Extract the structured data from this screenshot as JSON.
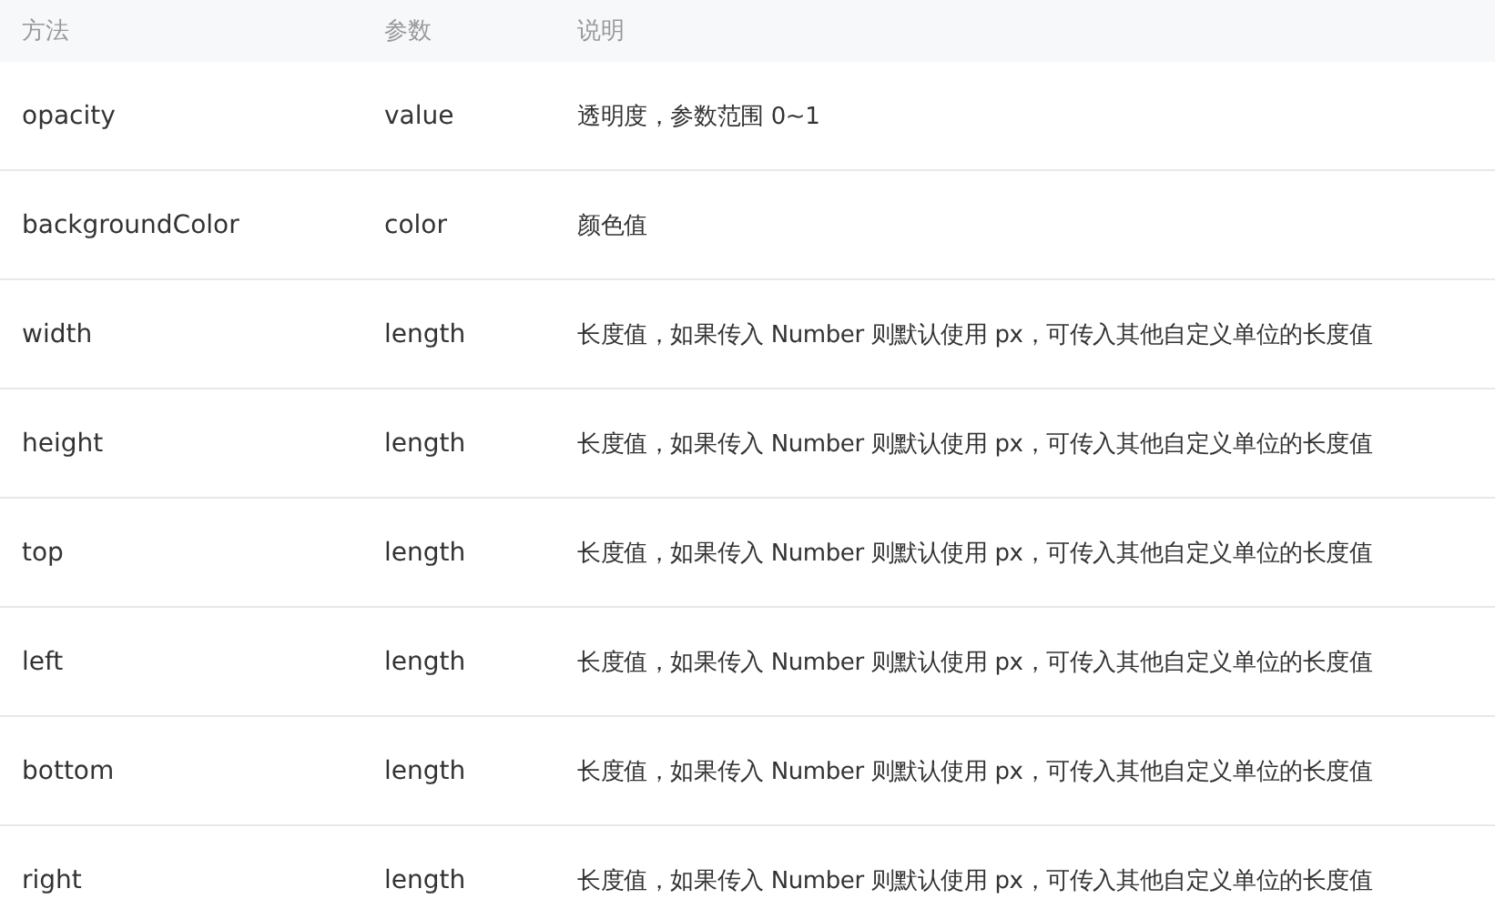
{
  "table": {
    "columns": [
      "方法",
      "参数",
      "说明"
    ],
    "rows": [
      [
        "opacity",
        "value",
        "透明度，参数范围 0~1"
      ],
      [
        "backgroundColor",
        "color",
        "颜色值"
      ],
      [
        "width",
        "length",
        "长度值，如果传入 Number 则默认使用 px，可传入其他自定义单位的长度值"
      ],
      [
        "height",
        "length",
        "长度值，如果传入 Number 则默认使用 px，可传入其他自定义单位的长度值"
      ],
      [
        "top",
        "length",
        "长度值，如果传入 Number 则默认使用 px，可传入其他自定义单位的长度值"
      ],
      [
        "left",
        "length",
        "长度值，如果传入 Number 则默认使用 px，可传入其他自定义单位的长度值"
      ],
      [
        "bottom",
        "length",
        "长度值，如果传入 Number 则默认使用 px，可传入其他自定义单位的长度值"
      ],
      [
        "right",
        "length",
        "长度值，如果传入 Number 则默认使用 px，可传入其他自定义单位的长度值"
      ]
    ]
  }
}
